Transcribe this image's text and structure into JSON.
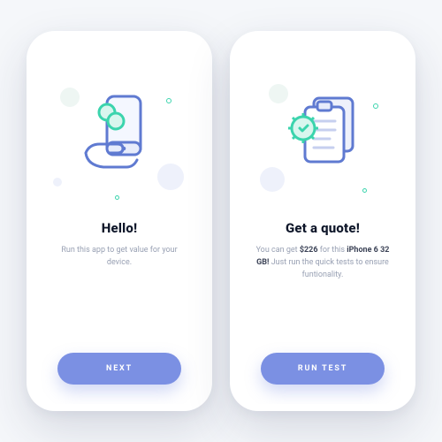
{
  "colors": {
    "accent_blue": "#7b90e3",
    "stroke_blue": "#5f7ad1",
    "mint": "#3bd4ad",
    "page_bg": "#f5f7fa",
    "text_dark": "#0f172a",
    "text_muted": "#98a0b3"
  },
  "screens": [
    {
      "id": "hello",
      "title": "Hello!",
      "subtitle": "Run this app to get value for your device.",
      "cta_label": "NEXT",
      "illustration": "phone-coins-hand"
    },
    {
      "id": "quote",
      "title": "Get a quote!",
      "subtitle_prefix": "You can get ",
      "subtitle_price": "$226",
      "subtitle_mid": " for this ",
      "subtitle_device": "iPhone 6 32 GB!",
      "subtitle_suffix": " Just run the quick tests to ensure funtionality.",
      "cta_label": "RUN TEST",
      "illustration": "clipboard-gear"
    }
  ]
}
